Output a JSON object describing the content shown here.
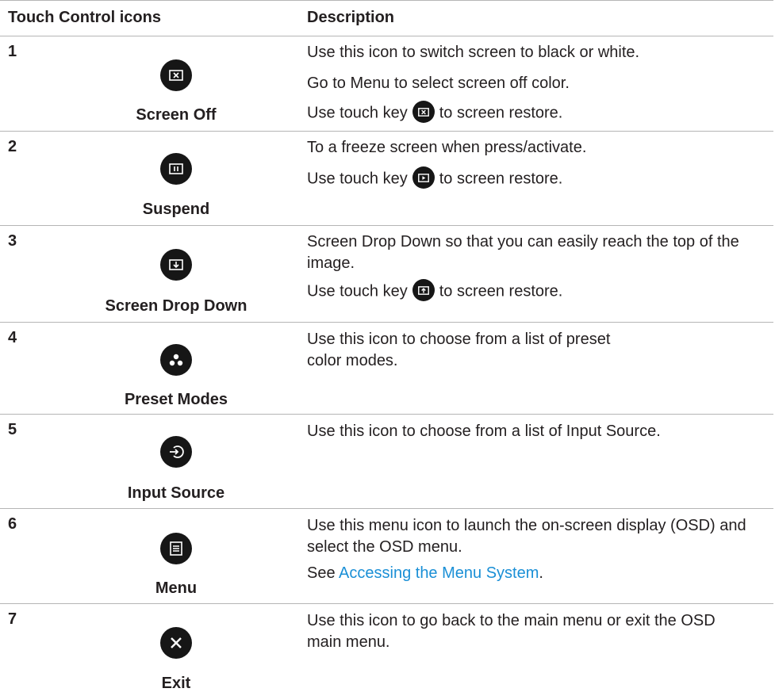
{
  "header": {
    "col1": "Touch Control icons",
    "col2": "Description"
  },
  "rows": [
    {
      "num": "1",
      "label": "Screen Off",
      "icon": "screen-off-icon",
      "desc": [
        "Use this icon to switch screen to black or white.",
        "Go to Menu to select screen off color.",
        {
          "pre": "Use touch key",
          "post": "to screen restore.",
          "icon": "screen-off-icon"
        }
      ]
    },
    {
      "num": "2",
      "label": "Suspend",
      "icon": "pause-icon",
      "desc": [
        "To a freeze screen when press/activate.",
        {
          "pre": "Use touch key",
          "post": "to screen restore.",
          "icon": "play-icon"
        }
      ]
    },
    {
      "num": "3",
      "label": "Screen Drop Down",
      "icon": "drop-down-icon",
      "desc": [
        "Screen Drop Down so that you can easily reach the top of the image.",
        {
          "pre": "Use touch key",
          "post": "to screen restore.",
          "icon": "drop-up-icon"
        }
      ]
    },
    {
      "num": "4",
      "label": "Preset Modes",
      "icon": "preset-modes-icon",
      "desc": [
        "Use this icon to choose from a list of preset color modes."
      ]
    },
    {
      "num": "5",
      "label": "Input Source",
      "icon": "input-source-icon",
      "desc": [
        "Use this icon to choose from a list of Input Source."
      ]
    },
    {
      "num": "6",
      "label": "Menu",
      "icon": "menu-icon",
      "desc": [
        "Use this menu icon to launch the on-screen display (OSD) and select the OSD menu.",
        {
          "pre": "See",
          "link": "Accessing the Menu System",
          "post": "."
        }
      ]
    },
    {
      "num": "7",
      "label": "Exit",
      "icon": "exit-icon",
      "desc": [
        "Use this icon to go back to the main menu or exit the OSD main menu."
      ]
    }
  ],
  "colors": {
    "text": "#231f20",
    "icon_bg": "#161616",
    "rule": "#b5b5b5",
    "link": "#1a8fd6"
  }
}
